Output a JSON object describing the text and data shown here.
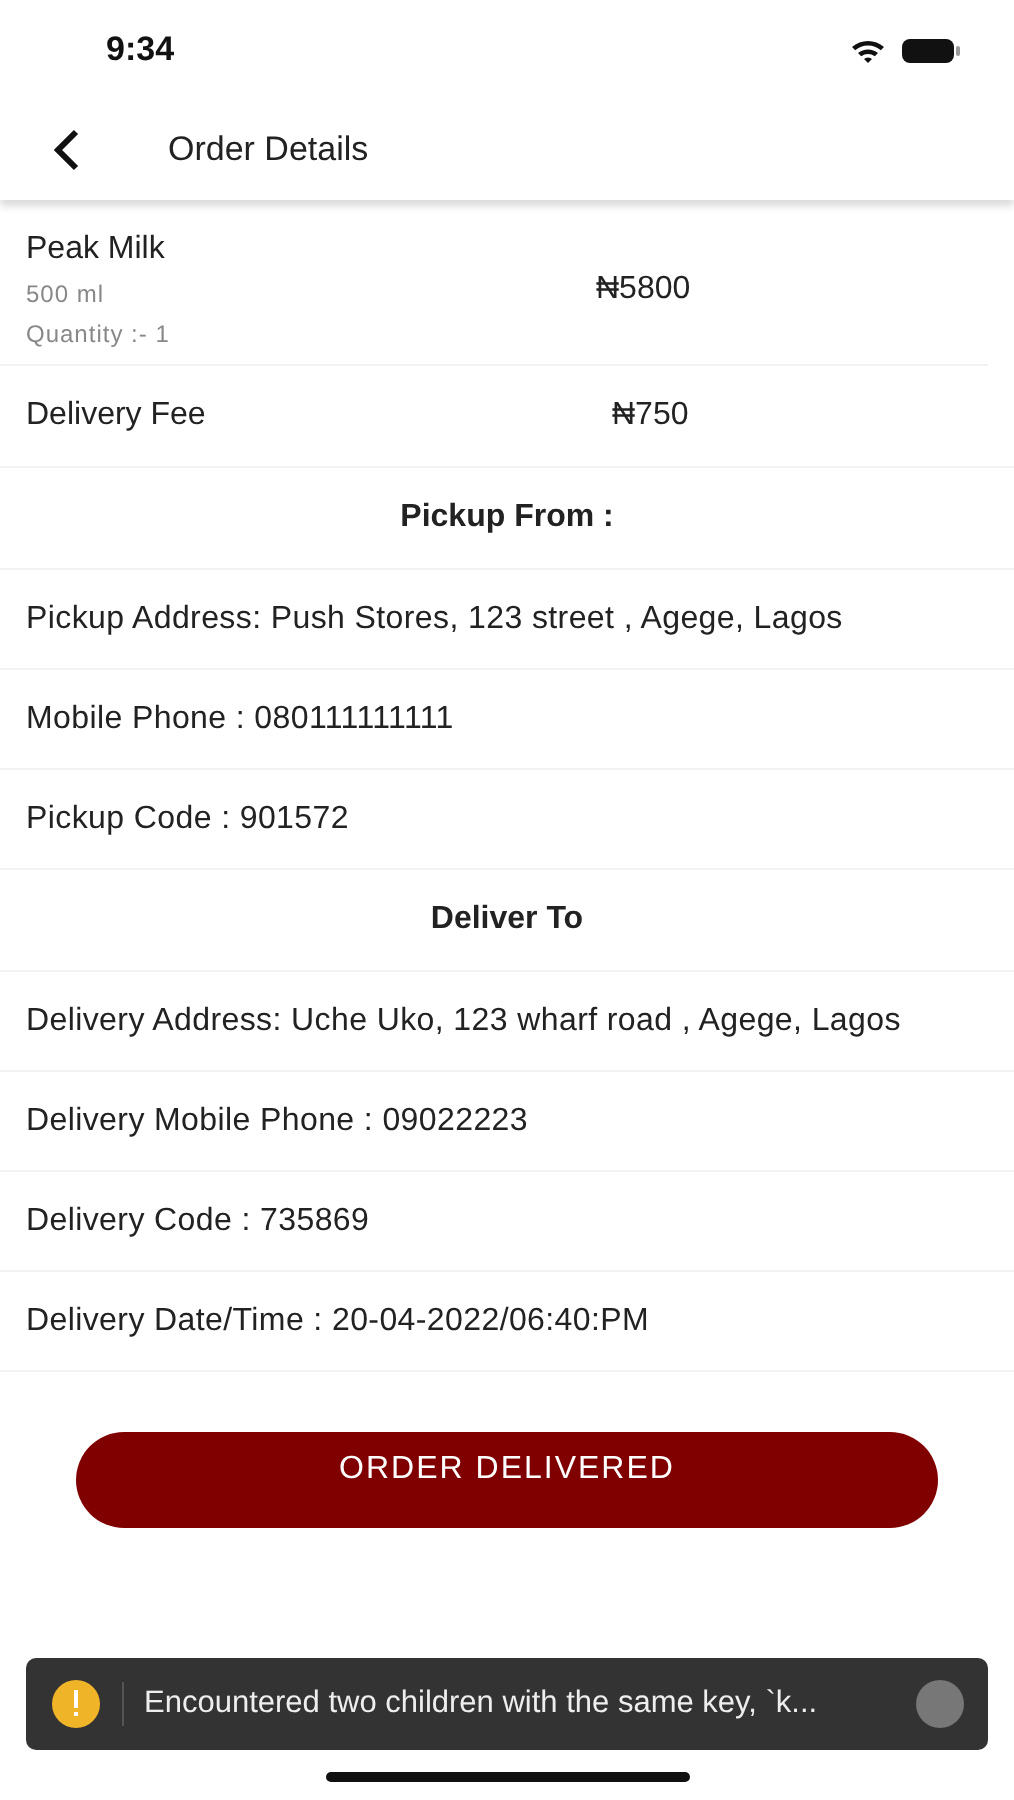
{
  "status_bar": {
    "time": "9:34"
  },
  "header": {
    "title": "Order Details"
  },
  "product": {
    "name": "Peak Milk",
    "size": "500 ml",
    "quantity": "Quantity :- 1",
    "price": "₦5800"
  },
  "fee": {
    "label": "Delivery Fee",
    "amount": "₦750"
  },
  "sections": [
    {
      "title": "Pickup From :",
      "rows": [
        "Pickup Address: Push Stores, 123 street , Agege, Lagos",
        "Mobile Phone : 080111111111",
        "Pickup Code : 901572"
      ]
    },
    {
      "title": "Deliver To",
      "rows": [
        "Delivery Address: Uche Uko, 123  wharf road  , Agege, Lagos",
        "Delivery Mobile Phone : 09022223",
        "Delivery Code : 735869",
        "Delivery Date/Time : 20-04-2022/06:40:PM"
      ]
    }
  ],
  "action_button": {
    "label": "ORDER DELIVERED"
  },
  "toast": {
    "message": "Encountered two children with the same key, `k..."
  }
}
